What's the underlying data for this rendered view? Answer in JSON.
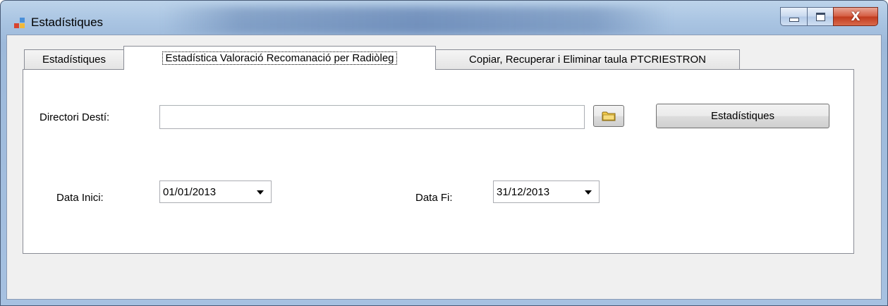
{
  "window": {
    "title": "Estadístiques",
    "close_glyph": "X"
  },
  "tabs": [
    {
      "label": "Estadístiques",
      "selected": false
    },
    {
      "label": "Estadística Valoració Recomanació per Radiòleg",
      "selected": true
    },
    {
      "label": "Copiar, Recuperar i Eliminar taula PTCRIESTRON",
      "selected": false
    }
  ],
  "form": {
    "directori_label": "Directori Destí:",
    "directori_value": "",
    "browse_icon": "folder-icon",
    "estadistiques_button": "Estadístiques",
    "data_inici_label": "Data Inici:",
    "data_inici_value": "01/01/2013",
    "data_fi_label": "Data Fi:",
    "data_fi_value": "31/12/2013"
  },
  "colors": {
    "frame": "#a9c4e2",
    "close_button": "#c13a1d",
    "folder_icon": "#f0c84a"
  }
}
